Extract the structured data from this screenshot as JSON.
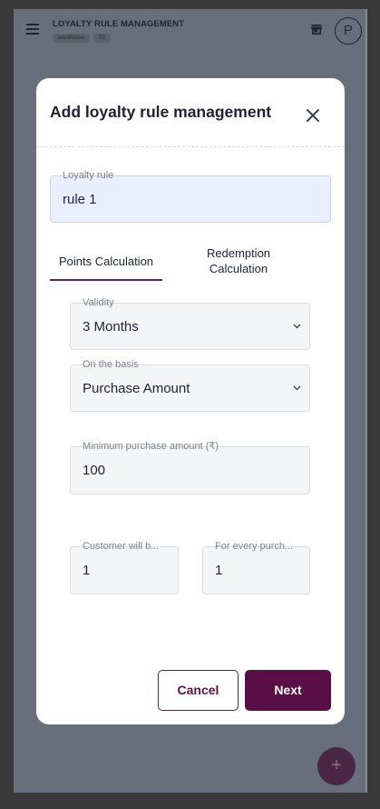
{
  "app": {
    "title": "LOYALTY RULE MANAGEMENT",
    "chips": [
      "warehouse",
      "02"
    ],
    "avatar_initial": "P",
    "fab_label": "+",
    "icons": {
      "menu": "hamburger-menu-icon",
      "store": "store-icon",
      "fab": "plus-icon"
    }
  },
  "modal": {
    "title": "Add loyalty rule management",
    "loyalty_rule": {
      "label": "Loyalty rule",
      "value": "rule 1"
    },
    "tabs": [
      {
        "label": "Points Calculation",
        "active": true
      },
      {
        "label": "Redemption Calculation",
        "active": false
      }
    ],
    "validity": {
      "label": "Validity",
      "value": "3 Months"
    },
    "basis": {
      "label": "On the basis",
      "value": "Purchase Amount"
    },
    "min_purchase": {
      "label": "Minimum purchase amount (₹)",
      "value": "100"
    },
    "customer_will": {
      "label": "Customer will b...",
      "value": "1"
    },
    "for_every": {
      "label": "For every purch...",
      "value": "1"
    },
    "buttons": {
      "cancel": "Cancel",
      "next": "Next"
    }
  },
  "colors": {
    "accent": "#5a0e46",
    "active_field_bg": "#e9efff",
    "backdrop": "#67707a"
  }
}
